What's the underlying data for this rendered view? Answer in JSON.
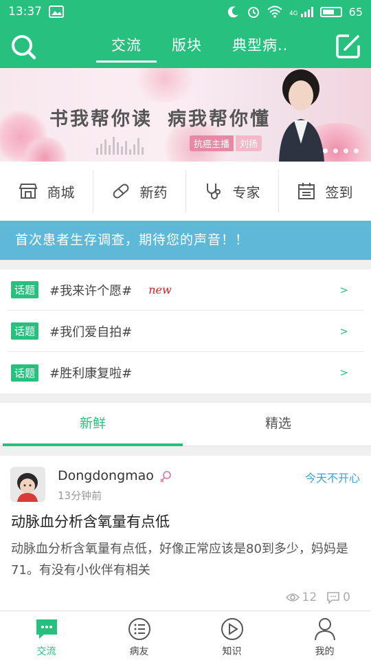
{
  "status": {
    "time": "13:37",
    "battery": "65",
    "network": "4G"
  },
  "topnav": {
    "tabs": [
      {
        "label": "交流",
        "active": true
      },
      {
        "label": "版块",
        "active": false
      },
      {
        "label": "典型病..",
        "active": false
      }
    ],
    "icons": {
      "search": "search-icon",
      "compose": "compose-icon"
    }
  },
  "banner": {
    "slogan_1": "书我帮你读",
    "slogan_2": "病我帮你懂",
    "host_tag": "抗癌主播",
    "host_name": "刘扬"
  },
  "quick_menu": [
    {
      "label": "商城",
      "icon": "store-icon"
    },
    {
      "label": "新药",
      "icon": "pill-icon"
    },
    {
      "label": "专家",
      "icon": "stethoscope-icon"
    },
    {
      "label": "签到",
      "icon": "calendar-icon"
    }
  ],
  "notice": "首次患者生存调查，期待您的声音！！",
  "topics": [
    {
      "badge": "话题",
      "title": "#我来许个愿#",
      "new": "new",
      "arrow": ">"
    },
    {
      "badge": "话题",
      "title": "#我们爱自拍#",
      "new": "",
      "arrow": ">"
    },
    {
      "badge": "话题",
      "title": "#胜利康复啦#",
      "new": "",
      "arrow": ">"
    }
  ],
  "feed_tabs": [
    {
      "label": "新鲜",
      "active": true
    },
    {
      "label": "精选",
      "active": false
    }
  ],
  "post": {
    "author": "Dongdongmao",
    "time": "13分钟前",
    "mood": "今天不开心",
    "title": "动脉血分析含氧量有点低",
    "body": "动脉血分析含氧量有点低，好像正常应该是80到多少，妈妈是71。有没有小伙伴有相关",
    "views": "12",
    "comments": "0"
  },
  "bottom_nav": [
    {
      "label": "交流",
      "icon": "chat-icon",
      "active": true
    },
    {
      "label": "病友",
      "icon": "list-icon",
      "active": false
    },
    {
      "label": "知识",
      "icon": "play-icon",
      "active": false
    },
    {
      "label": "我的",
      "icon": "person-icon",
      "active": false
    }
  ],
  "colors": {
    "primary": "#27c07f",
    "notice": "#5fb8d8",
    "mood": "#3aa0d8",
    "new": "#d02020"
  }
}
